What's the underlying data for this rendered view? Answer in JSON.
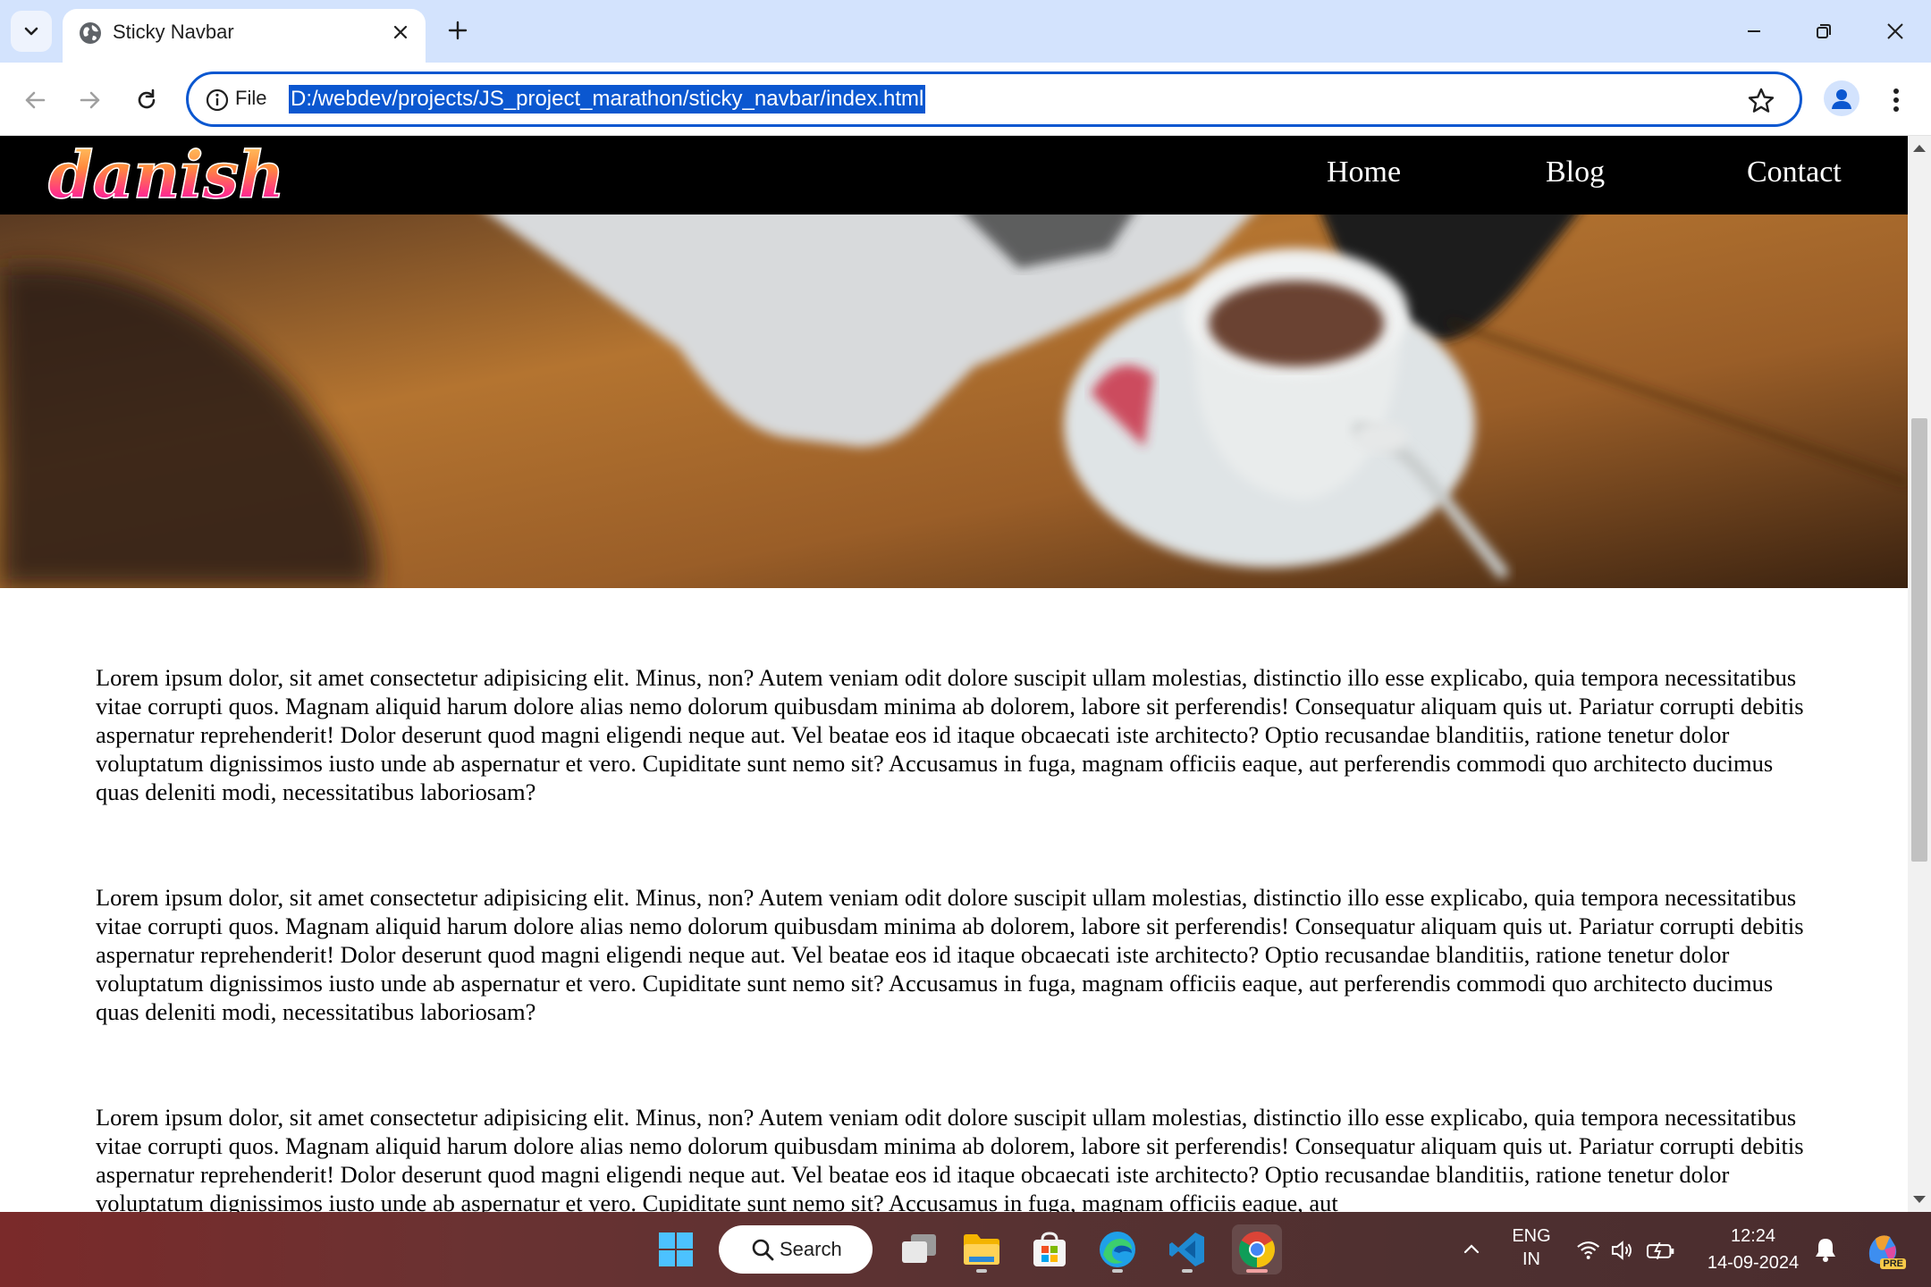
{
  "browser": {
    "tab_title": "Sticky Navbar",
    "url_scheme": "File",
    "url": "D:/webdev/projects/JS_project_marathon/sticky_navbar/index.html"
  },
  "site": {
    "logo_text": "danish",
    "nav": [
      "Home",
      "Blog",
      "Contact"
    ],
    "paragraphs": [
      "Lorem ipsum dolor, sit amet consectetur adipisicing elit. Minus, non? Autem veniam odit dolore suscipit ullam molestias, distinctio illo esse explicabo, quia tempora necessitatibus vitae corrupti quos. Magnam aliquid harum dolore alias nemo dolorum quibusdam minima ab dolorem, labore sit perferendis! Consequatur aliquam quis ut. Pariatur corrupti debitis aspernatur reprehenderit! Dolor deserunt quod magni eligendi neque aut. Vel beatae eos id itaque obcaecati iste architecto? Optio recusandae blanditiis, ratione tenetur dolor voluptatum dignissimos iusto unde ab aspernatur et vero. Cupiditate sunt nemo sit? Accusamus in fuga, magnam officiis eaque, aut perferendis commodi quo architecto ducimus quas deleniti modi, necessitatibus laboriosam?",
      "Lorem ipsum dolor, sit amet consectetur adipisicing elit. Minus, non? Autem veniam odit dolore suscipit ullam molestias, distinctio illo esse explicabo, quia tempora necessitatibus vitae corrupti quos. Magnam aliquid harum dolore alias nemo dolorum quibusdam minima ab dolorem, labore sit perferendis! Consequatur aliquam quis ut. Pariatur corrupti debitis aspernatur reprehenderit! Dolor deserunt quod magni eligendi neque aut. Vel beatae eos id itaque obcaecati iste architecto? Optio recusandae blanditiis, ratione tenetur dolor voluptatum dignissimos iusto unde ab aspernatur et vero. Cupiditate sunt nemo sit? Accusamus in fuga, magnam officiis eaque, aut perferendis commodi quo architecto ducimus quas deleniti modi, necessitatibus laboriosam?",
      "Lorem ipsum dolor, sit amet consectetur adipisicing elit. Minus, non? Autem veniam odit dolore suscipit ullam molestias, distinctio illo esse explicabo, quia tempora necessitatibus vitae corrupti quos. Magnam aliquid harum dolore alias nemo dolorum quibusdam minima ab dolorem, labore sit perferendis! Consequatur aliquam quis ut. Pariatur corrupti debitis aspernatur reprehenderit! Dolor deserunt quod magni eligendi neque aut. Vel beatae eos id itaque obcaecati iste architecto? Optio recusandae blanditiis, ratione tenetur dolor voluptatum dignissimos iusto unde ab aspernatur et vero. Cupiditate sunt nemo sit? Accusamus in fuga, magnam officiis eaque, aut"
    ]
  },
  "taskbar": {
    "search_label": "Search",
    "lang_primary": "ENG",
    "lang_secondary": "IN",
    "time": "12:24",
    "date": "14-09-2024",
    "copilot_badge": "PRE"
  },
  "colors": {
    "accent": "#0b57d0",
    "tabstrip": "#d3e3fd",
    "site_nav_bg": "#000000"
  }
}
